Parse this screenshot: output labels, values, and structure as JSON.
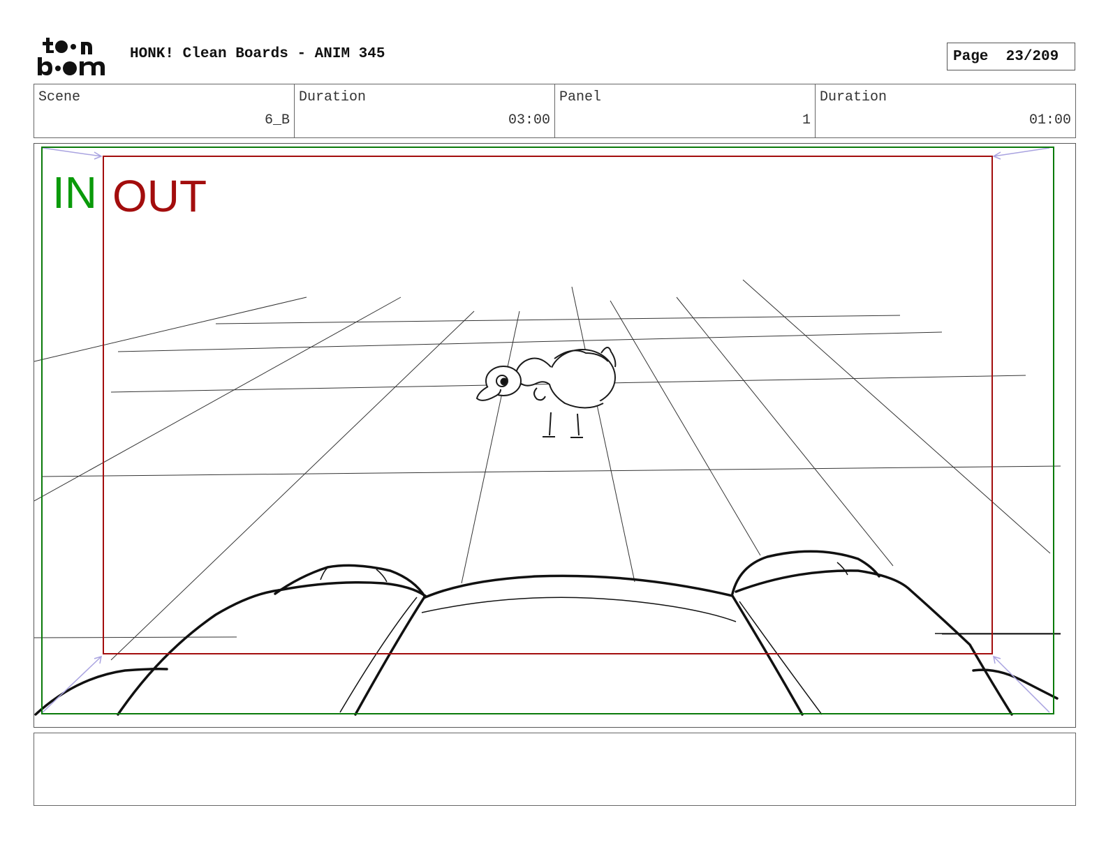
{
  "header": {
    "logo_text": "toon boom",
    "title": "HONK! Clean Boards - ANIM 345",
    "page": "Page  23/209"
  },
  "info": {
    "scene": {
      "label": "Scene",
      "value": "6_B"
    },
    "scene_duration": {
      "label": "Duration",
      "value": "03:00"
    },
    "panel": {
      "label": "Panel",
      "value": "1"
    },
    "panel_duration": {
      "label": "Duration",
      "value": "01:00"
    }
  },
  "panel": {
    "in_label": "IN",
    "out_label": "OUT",
    "in_color": "#0a9a0a",
    "out_color": "#a30d0d"
  },
  "notes": {
    "text": ""
  }
}
